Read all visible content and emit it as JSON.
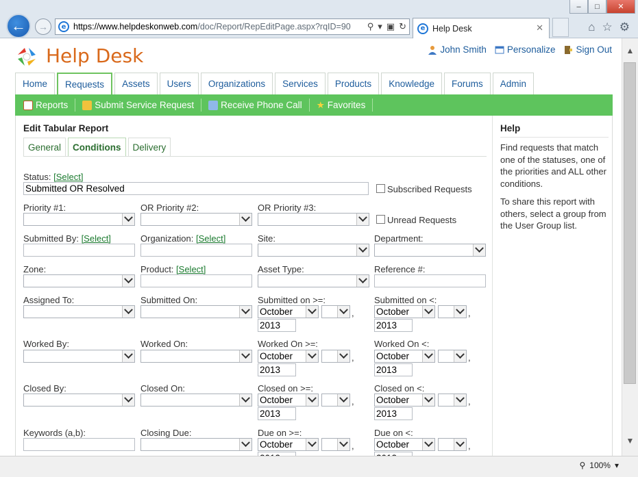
{
  "browser": {
    "url_host": "https://www.helpdeskonweb.com",
    "url_path": "/doc/Report/RepEditPage.aspx?rqID=90",
    "tab_title": "Help Desk",
    "zoom": "100%",
    "window_buttons": [
      "–",
      "□",
      "✕"
    ]
  },
  "site": {
    "title": "Help Desk",
    "user_name": "John Smith",
    "personalize": "Personalize",
    "sign_out": "Sign Out"
  },
  "main_tabs": [
    "Home",
    "Requests",
    "Assets",
    "Users",
    "Organizations",
    "Services",
    "Products",
    "Knowledge",
    "Forums",
    "Admin"
  ],
  "active_main_tab": "Requests",
  "actions": [
    "Reports",
    "Submit Service Request",
    "Receive Phone Call",
    "Favorites"
  ],
  "panel": {
    "title": "Edit Tabular Report",
    "tabs": [
      "General",
      "Conditions",
      "Delivery"
    ],
    "active_tab": "Conditions"
  },
  "form": {
    "select_link": "[Select]",
    "status_label": "Status:",
    "status_value": "Submitted OR Resolved",
    "subscribed_label": "Subscribed Requests",
    "unread_label": "Unread Requests",
    "priority1_label": "Priority #1:",
    "priority2_label": "OR Priority #2:",
    "priority3_label": "OR Priority #3:",
    "submitted_by_label": "Submitted By:",
    "organization_label": "Organization:",
    "site_label": "Site:",
    "department_label": "Department:",
    "zone_label": "Zone:",
    "product_label": "Product:",
    "asset_type_label": "Asset Type:",
    "reference_label": "Reference #:",
    "assigned_to_label": "Assigned To:",
    "submitted_on_label": "Submitted On:",
    "submitted_on_gte_label": "Submitted on >=:",
    "submitted_on_lt_label": "Submitted on <:",
    "worked_by_label": "Worked By:",
    "worked_on_label": "Worked On:",
    "worked_on_gte_label": "Worked On >=:",
    "worked_on_lt_label": "Worked On <:",
    "closed_by_label": "Closed By:",
    "closed_on_label": "Closed On:",
    "closed_on_gte_label": "Closed on >=:",
    "closed_on_lt_label": "Closed on <:",
    "keywords_label": "Keywords (a,b):",
    "closing_due_label": "Closing Due:",
    "due_on_gte_label": "Due on >=:",
    "due_on_lt_label": "Due on <:",
    "month_value": "October",
    "year_value": "2013",
    "comma": ","
  },
  "help": {
    "title": "Help",
    "p1": "Find requests that match one of the statuses, one of the priorities and ALL other conditions.",
    "p2": "To share this report with others, select a group from the User Group list."
  },
  "colors": {
    "brand_orange": "#d9691b",
    "action_green": "#5ec45d",
    "link_blue": "#1d5c9c",
    "link_green": "#1a7a2e"
  }
}
